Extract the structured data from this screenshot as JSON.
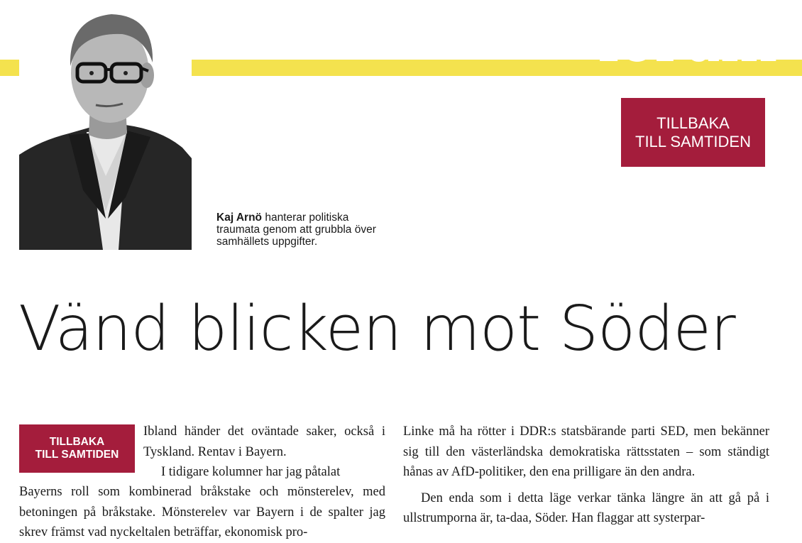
{
  "section": {
    "word": "forum"
  },
  "colors": {
    "accent": "#a41d3c",
    "band": "#f4e24e"
  },
  "column_badge": {
    "line1": "TILLBAKA",
    "line2": "TILL SAMTIDEN"
  },
  "caption": {
    "author": "Kaj Arnö",
    "text": " hanterar politiska traumata genom att grubbla över samhällets uppgifter."
  },
  "headline": "Vänd blicken mot Söder",
  "body": {
    "col1_intro": "Ibland händer det oväntade saker, också i Tyskland. Rentav i Bayern.",
    "col1_para2_start": "I tidigare kolumner har jag påtalat",
    "col1_para2_rest": "Bayerns roll som kombinerad bråkstake och mönsterelev, med betoningen på bråkstake. Mönsterelev var Bayern i de spalter jag skrev främst vad nyckeltalen beträffar, ekonomisk pro-",
    "col2_para1": "Linke må ha rötter i DDR:s statsbärande parti SED, men bekänner sig till den västerländska demokratiska rättsstaten – som ständigt hånas av AfD-politiker, den ena prilligare än den andra.",
    "col2_para2": "Den enda som i detta läge verkar tänka längre än att gå på i ullstrumporna är, ta-daa, Söder. Han flaggar att systerpar-"
  }
}
